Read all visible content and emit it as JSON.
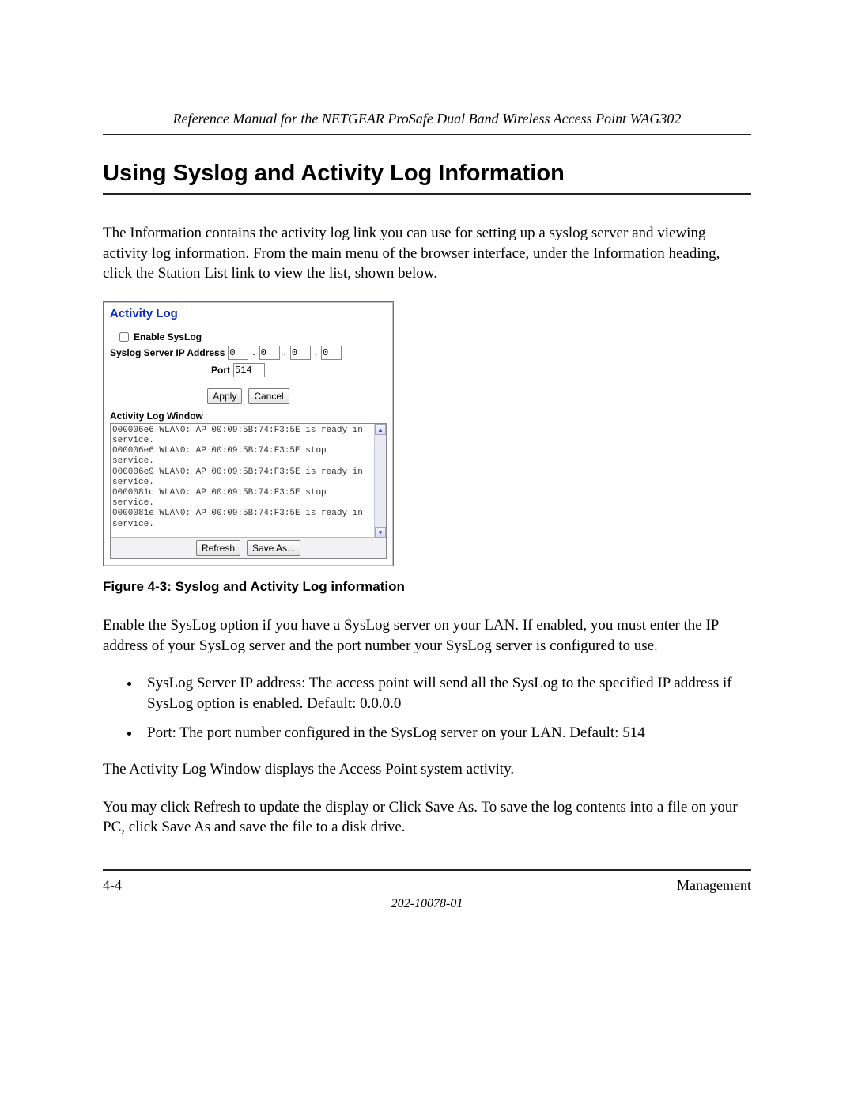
{
  "header": "Reference Manual for the NETGEAR ProSafe Dual Band Wireless Access Point WAG302",
  "title": "Using Syslog and Activity Log Information",
  "intro": "The Information contains the activity log link you can use for setting up a syslog server and viewing activity log information. From the main menu of the browser interface, under the Information heading, click the Station List link to view the list, shown below.",
  "screenshot": {
    "panel_title": "Activity Log",
    "enable_label": "Enable SysLog",
    "ip_label": "Syslog Server IP Address",
    "ip": [
      "0",
      "0",
      "0",
      "0"
    ],
    "port_label": "Port",
    "port_value": "514",
    "btn_apply": "Apply",
    "btn_cancel": "Cancel",
    "logwin_header": "Activity Log Window",
    "log_text": "000006e6 WLAN0: AP 00:09:5B:74:F3:5E is ready in service.\n000006e6 WLAN0: AP 00:09:5B:74:F3:5E stop service.\n000006e9 WLAN0: AP 00:09:5B:74:F3:5E is ready in service.\n0000081c WLAN0: AP 00:09:5B:74:F3:5E stop service.\n0000081e WLAN0: AP 00:09:5B:74:F3:5E is ready in service.",
    "btn_refresh": "Refresh",
    "btn_saveas": "Save As..."
  },
  "figure_caption": "Figure 4-3:  Syslog and Activity Log information",
  "para_enable": "Enable the SysLog option if you have a SysLog server on your LAN. If enabled, you must enter the IP address of your SysLog server and the port number your SysLog server is configured to use.",
  "bullets": [
    "SysLog Server IP address: The access point will send all the SysLog to the specified IP address if SysLog option is enabled. Default: 0.0.0.0",
    "Port: The port number configured in the SysLog server on your LAN. Default: 514"
  ],
  "para_logwin": "The Activity Log Window displays the Access Point system activity.",
  "para_refresh": "You may click Refresh to update the display or Click Save As. To save the log contents into a file on your PC, click Save As and save the file to a disk drive.",
  "footer": {
    "page": "4-4",
    "section": "Management",
    "docnum": "202-10078-01"
  }
}
